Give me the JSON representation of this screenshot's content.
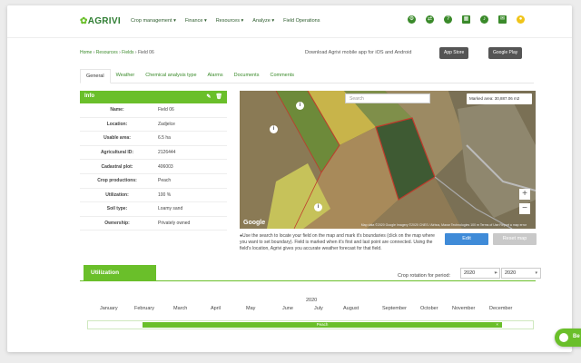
{
  "app": {
    "logo": "AGRIVI"
  },
  "nav": {
    "items": [
      "Crop management ▾",
      "Finance ▾",
      "Resources ▾",
      "Analyze ▾",
      "Field Operations"
    ],
    "icons": [
      "gear-icon",
      "transfer-icon",
      "help-icon",
      "calendar-icon",
      "notification-icon",
      "message-icon",
      "user-icon"
    ]
  },
  "breadcrumb": {
    "home": "Home",
    "resources": "Resources",
    "fields": "Fields",
    "current": "Field 06",
    "sep": " › "
  },
  "download": {
    "text": "Download Agrivi mobile app for iOS and Android",
    "appstore": "App Store",
    "googleplay": "Google Play"
  },
  "tabs": [
    "General",
    "Weather",
    "Chemical analysis type",
    "Alarms",
    "Documents",
    "Comments"
  ],
  "info": {
    "title": "Info",
    "rows": [
      {
        "label": "Name:",
        "value": "Field 06"
      },
      {
        "label": "Location:",
        "value": "Zadjelce"
      },
      {
        "label": "Usable area:",
        "value": "6.5 ha"
      },
      {
        "label": "Agricultural ID:",
        "value": "2126444"
      },
      {
        "label": "Cadastral plot:",
        "value": "406003"
      },
      {
        "label": "Crop productions:",
        "value": "Peach"
      },
      {
        "label": "Utilization:",
        "value": "100 %"
      },
      {
        "label": "Soil type:",
        "value": "Loamy sand"
      },
      {
        "label": "Ownership:",
        "value": "Privately owned"
      }
    ]
  },
  "map": {
    "search_placeholder": "Search",
    "marked_area": "Marked area: 30,887.06 m2",
    "google": "Google",
    "footer": "Map data ©2020 Google Imagery ©2020 CNES / Airbus, Maxar Technologies   100 m   Terms of Use   Report a map error",
    "zoom_in": "+",
    "zoom_out": "−"
  },
  "help_text": "Use the search to locate your field on the map and mark it's boundaries (click on the map where you want to set boundary). Field is marked when it's first and last point are connected. Using the field's location, Agrivi gives you accurate weather forecast for that field.",
  "buttons": {
    "edit": "Edit",
    "reset": "Reset map"
  },
  "utilization": {
    "title": "Utilization",
    "crop_rotation_label": "Crop rotation for period:",
    "from_year": "2020",
    "to_year": "2020",
    "year": "2020",
    "months": [
      "January",
      "February",
      "March",
      "April",
      "May",
      "June",
      "July",
      "August",
      "September",
      "October",
      "November",
      "December"
    ],
    "segment_label": "Peach",
    "segment_end": "×"
  },
  "chat": {
    "label": "Be"
  }
}
